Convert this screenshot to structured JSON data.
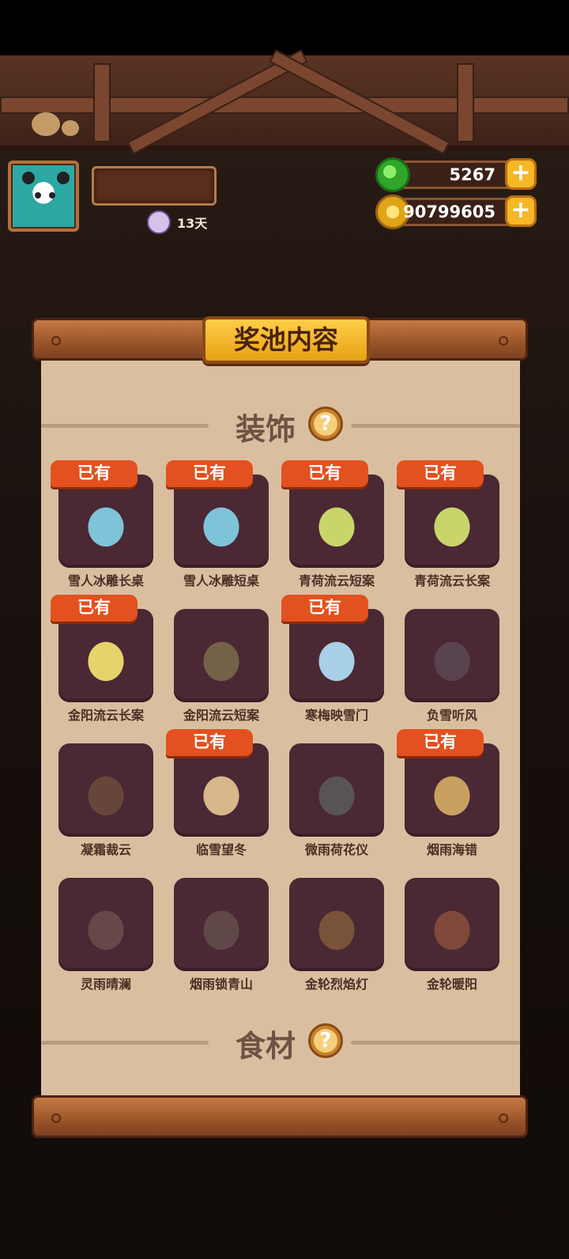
{
  "hud": {
    "days": "13天",
    "gems": "5267",
    "coins": "90799605",
    "plus_label": "+"
  },
  "panel": {
    "title": "奖池内容",
    "section_decor": "装饰",
    "section_food": "食材",
    "help_label": "?",
    "owned_label": "已有"
  },
  "items": [
    {
      "name": "雪人冰雕长桌",
      "owned": true
    },
    {
      "name": "雪人冰雕短桌",
      "owned": true
    },
    {
      "name": "青荷流云短案",
      "owned": true
    },
    {
      "name": "青荷流云长案",
      "owned": true
    },
    {
      "name": "金阳流云长案",
      "owned": true
    },
    {
      "name": "金阳流云短案",
      "owned": false
    },
    {
      "name": "寒梅映雪门",
      "owned": true
    },
    {
      "name": "负雪听风",
      "owned": false
    },
    {
      "name": "凝霜裁云",
      "owned": false
    },
    {
      "name": "临雪望冬",
      "owned": true
    },
    {
      "name": "微雨荷花仪",
      "owned": false
    },
    {
      "name": "烟雨海错",
      "owned": true
    },
    {
      "name": "灵雨晴澜",
      "owned": false
    },
    {
      "name": "烟雨锁青山",
      "owned": false
    },
    {
      "name": "金轮烈焰灯",
      "owned": false
    },
    {
      "name": "金轮暖阳",
      "owned": false
    }
  ]
}
